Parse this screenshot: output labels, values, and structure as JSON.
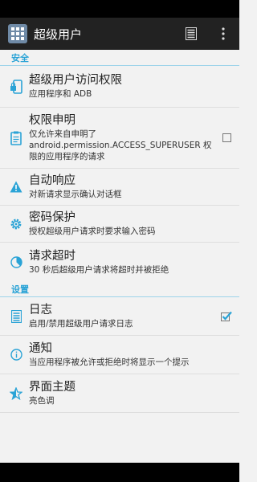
{
  "app": {
    "title": "超级用户",
    "icon": "grid-app-icon",
    "accent": "#2aa3d6"
  },
  "actionbar": {
    "log_icon": "list-icon",
    "menu_icon": "overflow-menu-icon"
  },
  "sections": {
    "security": "安全",
    "settings": "设置"
  },
  "prefs": {
    "access": {
      "title": "超级用户访问权限",
      "summary": "应用程序和 ADB",
      "icon": "lock-phone-icon"
    },
    "declared": {
      "title": "权限申明",
      "summary": "仅允许来自申明了 android.permission.ACCESS_SUPERUSER 权限的应用程序的请求",
      "icon": "clipboard-icon",
      "checked": false
    },
    "auto": {
      "title": "自动响应",
      "summary": "对新请求显示确认对话框",
      "icon": "warning-icon"
    },
    "pin": {
      "title": "密码保护",
      "summary": "授权超级用户请求时要求输入密码",
      "icon": "gear-icon"
    },
    "timeout": {
      "title": "请求超时",
      "summary": "30 秒后超级用户请求将超时并被拒绝",
      "icon": "timer-icon"
    },
    "logging": {
      "title": "日志",
      "summary": "启用/禁用超级用户请求日志",
      "icon": "list-icon",
      "checked": true
    },
    "notify": {
      "title": "通知",
      "summary": "当应用程序被允许或拒绝时将显示一个提示",
      "icon": "info-icon"
    },
    "theme": {
      "title": "界面主题",
      "summary": "亮色调",
      "icon": "star-icon"
    }
  }
}
